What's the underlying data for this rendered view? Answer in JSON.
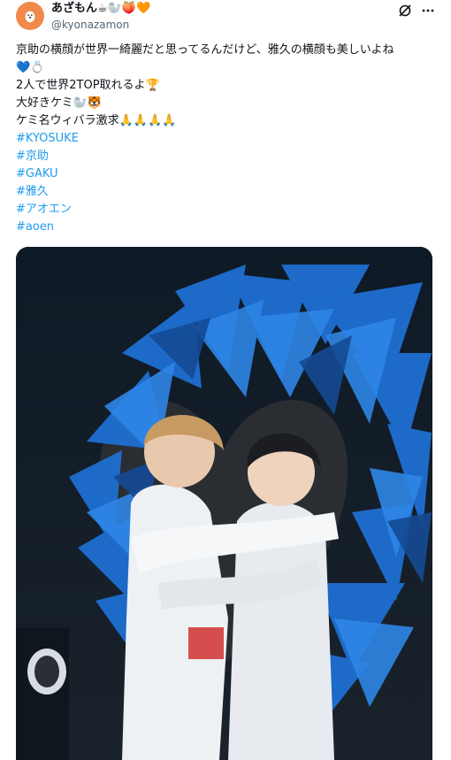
{
  "post": {
    "display_name": "あざもん☕🦭🍑🧡",
    "handle": "@kyonazamon",
    "lines": [
      "京助の横顔が世界一綺麗だと思ってるんだけど、雅久の横顔も美しいよね",
      "💙💍",
      "2人で世界2TOP取れるよ🏆",
      "大好きケミ🦭🐯",
      "ケミ名ウィバラ激求🙏🙏🙏🙏"
    ],
    "hashtags": [
      "#KYOSUKE",
      "#京助",
      "#GAKU",
      "#雅久",
      "#アオエン",
      "#aoen"
    ]
  },
  "icons": {
    "avatar": "seal-avatar-icon",
    "grok": "grok-icon",
    "more": "more-icon"
  },
  "colors": {
    "link": "#1d9bf0",
    "avatar_bg": "#f08a4b",
    "heart_blue": "#1f6fd1"
  }
}
